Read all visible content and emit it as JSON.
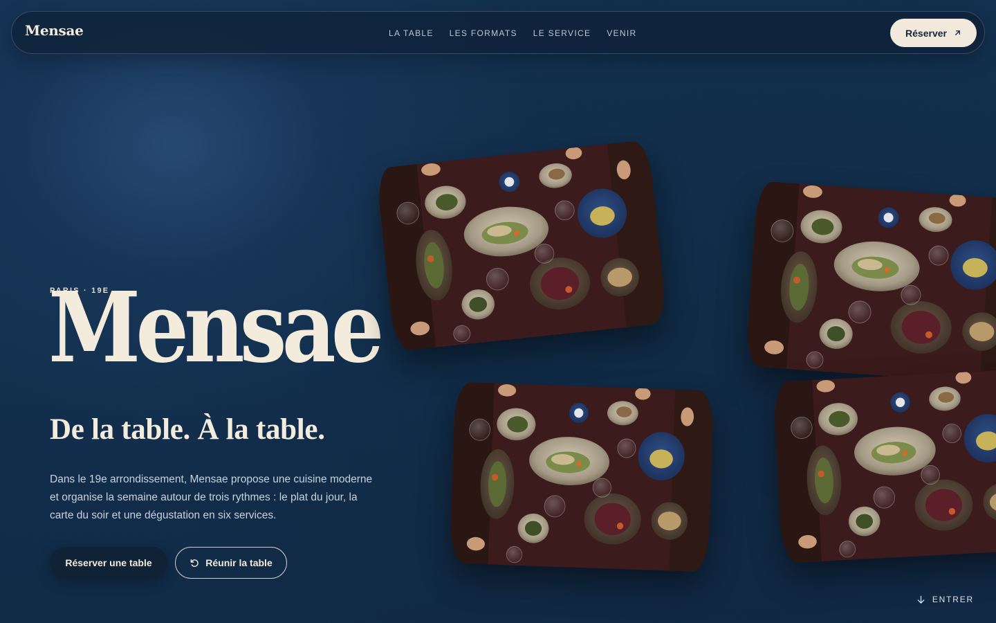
{
  "header": {
    "brand": "Mensae",
    "nav": [
      "LA TABLE",
      "LES FORMATS",
      "LE SERVICE",
      "VENIR"
    ],
    "cta_label": "Réserver",
    "cta_icon": "arrow-up-right-icon"
  },
  "hero": {
    "eyebrow": "PARIS · 19E",
    "title": "Mensae",
    "tagline": "De la table. À la table.",
    "description": "Dans le 19e arrondissement, Mensae propose une cuisine moderne et organise la semaine autour de trois rythmes : le plat du jour, la carte du soir et une dégustation en six services.",
    "primary_button": "Réserver une table",
    "secondary_button": "Réunir la table",
    "secondary_icon": "refresh-icon"
  },
  "scroll_hint": {
    "label": "ENTRER",
    "icon": "arrow-down-icon"
  },
  "gallery": {
    "image_subject": "overhead view of shared dishes on a dark wooden table",
    "count": 4
  },
  "colors": {
    "background": "#12304f",
    "cream": "#f3ebdc",
    "nav_bar": "#0e2034",
    "table_wood": "#3a1c1d"
  }
}
